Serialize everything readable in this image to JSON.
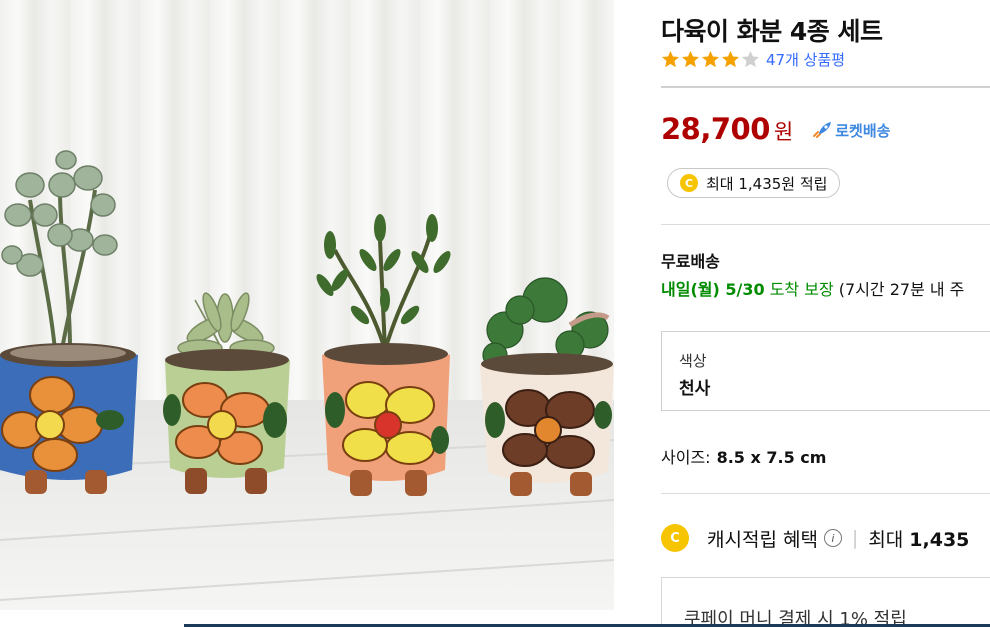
{
  "product": {
    "title": "다육이 화분 4종 세트",
    "rating_stars": 4,
    "rating_max": 5,
    "review_count": "47개 상품평",
    "price": "28,700",
    "currency": "원",
    "delivery_badge": "로켓배송",
    "cash_reward": "최대 1,435원 적립"
  },
  "shipping": {
    "label": "무료배송",
    "eta_day": "내일(월) 5/30",
    "eta_guarantee": "도착 보장",
    "eta_note": "(7시간 27분  내 주"
  },
  "option": {
    "label": "색상",
    "value": "천사"
  },
  "size": {
    "label": "사이즈:",
    "value": "8.5 x 7.5 cm"
  },
  "cash_benefit": {
    "label": "캐시적립 혜택",
    "info_icon": "info-icon",
    "max_label": "최대",
    "max_value": "1,435"
  },
  "coupay": {
    "text": "쿠페이 머니 결제 시 1% 적립"
  },
  "colors": {
    "price": "#ae0000",
    "review_link": "#346aff",
    "rocket": "#3d88e0",
    "shipping_green": "#008c00",
    "star": "#f5a200",
    "coin": "#f7c400"
  },
  "coin_letter": "C"
}
